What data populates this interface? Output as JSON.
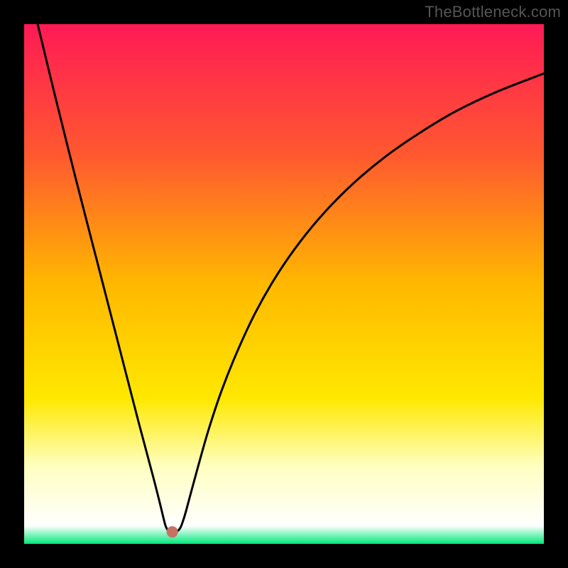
{
  "watermark": "TheBottleneck.com",
  "chart_data": {
    "type": "line",
    "title": "",
    "xlabel": "",
    "ylabel": "",
    "xlim": [
      0,
      1
    ],
    "ylim": [
      0,
      1
    ],
    "background_gradient": [
      {
        "stop": 0.0,
        "color": "#ff1a55"
      },
      {
        "stop": 0.25,
        "color": "#ff5830"
      },
      {
        "stop": 0.5,
        "color": "#ffb800"
      },
      {
        "stop": 0.72,
        "color": "#ffe800"
      },
      {
        "stop": 0.85,
        "color": "#feffbf"
      },
      {
        "stop": 0.965,
        "color": "#ffffff"
      },
      {
        "stop": 1.0,
        "color": "#00e87a"
      }
    ],
    "marker": {
      "x": 0.285,
      "y": 0.977,
      "color": "#c97064",
      "r_frac": 0.011
    },
    "series": [
      {
        "name": "bottleneck-curve",
        "points": [
          {
            "x": 0.026,
            "y": 0.0
          },
          {
            "x": 0.06,
            "y": 0.14
          },
          {
            "x": 0.1,
            "y": 0.3
          },
          {
            "x": 0.14,
            "y": 0.455
          },
          {
            "x": 0.18,
            "y": 0.61
          },
          {
            "x": 0.22,
            "y": 0.765
          },
          {
            "x": 0.248,
            "y": 0.87
          },
          {
            "x": 0.262,
            "y": 0.925
          },
          {
            "x": 0.268,
            "y": 0.95
          },
          {
            "x": 0.272,
            "y": 0.965
          },
          {
            "x": 0.276,
            "y": 0.973
          },
          {
            "x": 0.282,
            "y": 0.977
          },
          {
            "x": 0.292,
            "y": 0.977
          },
          {
            "x": 0.3,
            "y": 0.97
          },
          {
            "x": 0.306,
            "y": 0.955
          },
          {
            "x": 0.312,
            "y": 0.935
          },
          {
            "x": 0.32,
            "y": 0.905
          },
          {
            "x": 0.335,
            "y": 0.85
          },
          {
            "x": 0.355,
            "y": 0.78
          },
          {
            "x": 0.38,
            "y": 0.705
          },
          {
            "x": 0.41,
            "y": 0.63
          },
          {
            "x": 0.445,
            "y": 0.555
          },
          {
            "x": 0.485,
            "y": 0.485
          },
          {
            "x": 0.53,
            "y": 0.42
          },
          {
            "x": 0.58,
            "y": 0.36
          },
          {
            "x": 0.635,
            "y": 0.305
          },
          {
            "x": 0.695,
            "y": 0.255
          },
          {
            "x": 0.76,
            "y": 0.21
          },
          {
            "x": 0.83,
            "y": 0.168
          },
          {
            "x": 0.91,
            "y": 0.13
          },
          {
            "x": 1.0,
            "y": 0.095
          }
        ]
      }
    ]
  }
}
